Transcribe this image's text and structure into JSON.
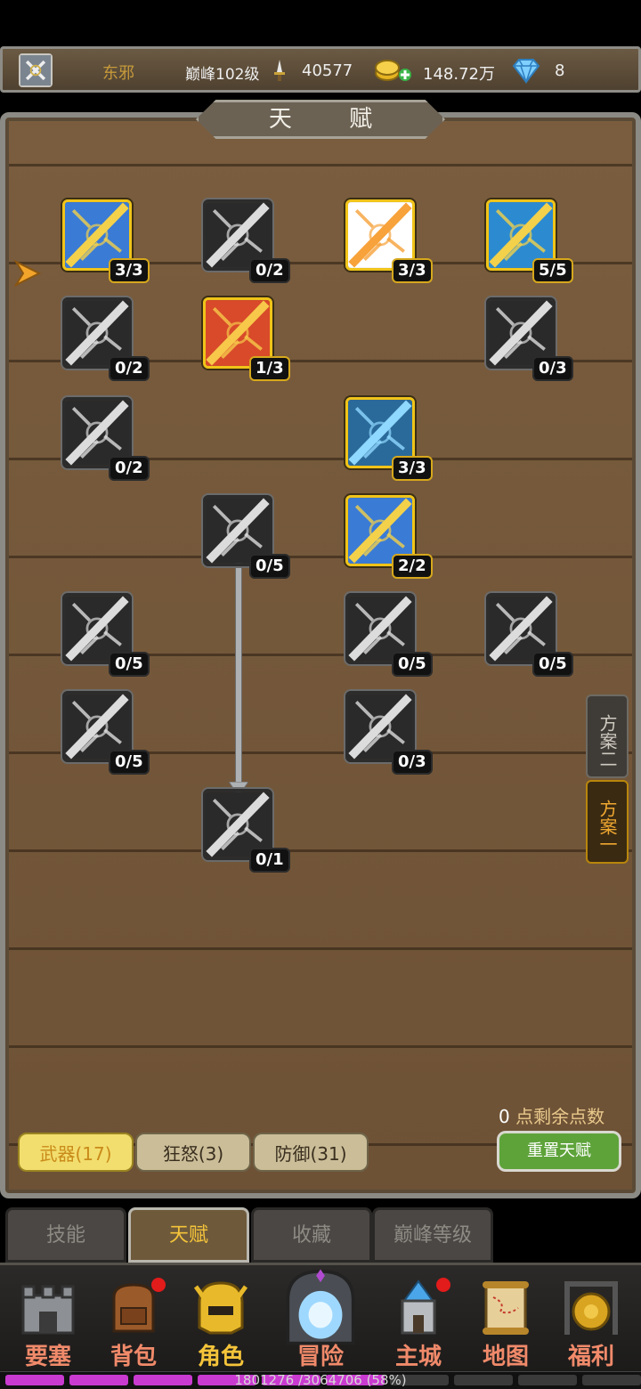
{
  "header": {
    "player_name": "东邪",
    "peak_level": "巅峰102级",
    "power": "40577",
    "gold": "148.72万",
    "diamonds": "8"
  },
  "panel": {
    "title": "天 赋"
  },
  "talents": [
    {
      "level": "3/3",
      "active": true
    },
    {
      "level": "0/2",
      "active": false
    },
    {
      "level": "3/3",
      "active": true
    },
    {
      "level": "5/5",
      "active": true
    },
    {
      "level": "0/2",
      "active": false
    },
    {
      "level": "1/3",
      "active": true
    },
    {
      "level": "0/3",
      "active": false
    },
    {
      "level": "0/2",
      "active": false
    },
    {
      "level": "3/3",
      "active": true
    },
    {
      "level": "0/5",
      "active": false
    },
    {
      "level": "2/2",
      "active": true
    },
    {
      "level": "0/5",
      "active": false
    },
    {
      "level": "0/5",
      "active": false
    },
    {
      "level": "0/5",
      "active": false
    },
    {
      "level": "0/5",
      "active": false
    },
    {
      "level": "0/3",
      "active": false
    },
    {
      "level": "0/1",
      "active": false
    }
  ],
  "plans": {
    "plan_two": "方案二",
    "plan_one": "方案一"
  },
  "points": {
    "count": "0",
    "label": "点剩余点数"
  },
  "categories": {
    "weapon": "武器(17)",
    "rage": "狂怒(3)",
    "defense": "防御(31)"
  },
  "reset_label": "重置天赋",
  "subtabs": {
    "skills": "技能",
    "talent": "天赋",
    "collection": "收藏",
    "peak": "巅峰等级"
  },
  "nav": {
    "fortress": "要塞",
    "backpack": "背包",
    "character": "角色",
    "adventure": "冒险",
    "main_city": "主城",
    "map": "地图",
    "welfare": "福利"
  },
  "xp_text": "1801276 /3064706 (58%)",
  "xp_progress": 0.58,
  "colors": {
    "accent_gold": "#f5c43a",
    "active_border": "#f0c419",
    "reset_green": "#5ea33a",
    "xp_purple": "#c93ad0"
  }
}
